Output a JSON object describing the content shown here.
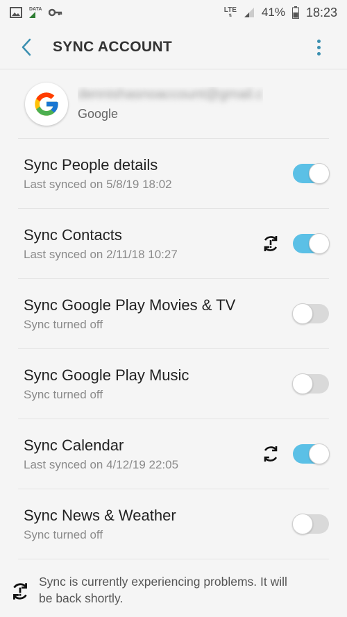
{
  "status_bar": {
    "data_label": "DATA",
    "lte_label": "LTE",
    "battery": "41%",
    "time": "18:23"
  },
  "app_bar": {
    "title": "SYNC ACCOUNT"
  },
  "account": {
    "email": "dennishasnoaccount@gmail.c",
    "type": "Google"
  },
  "sync_items": [
    {
      "title": "Sync People details",
      "subtitle": "Last synced on 5/8/19  18:02",
      "enabled": true,
      "syncing_icon": false
    },
    {
      "title": "Sync Contacts",
      "subtitle": "Last synced on 2/11/18  10:27",
      "enabled": true,
      "syncing_icon": true,
      "sync_error": true
    },
    {
      "title": "Sync Google Play Movies & TV",
      "subtitle": "Sync turned off",
      "enabled": false,
      "syncing_icon": false
    },
    {
      "title": "Sync Google Play Music",
      "subtitle": "Sync turned off",
      "enabled": false,
      "syncing_icon": false
    },
    {
      "title": "Sync Calendar",
      "subtitle": "Last synced on 4/12/19  22:05",
      "enabled": true,
      "syncing_icon": true,
      "sync_error": false
    },
    {
      "title": "Sync News & Weather",
      "subtitle": "Sync turned off",
      "enabled": false,
      "syncing_icon": false
    }
  ],
  "footer": {
    "message": "Sync is currently experiencing problems. It will be back shortly."
  },
  "colors": {
    "toggle_on": "#5bc0e6",
    "toggle_off": "#d9d9d9",
    "accent": "#3a8fb0"
  }
}
